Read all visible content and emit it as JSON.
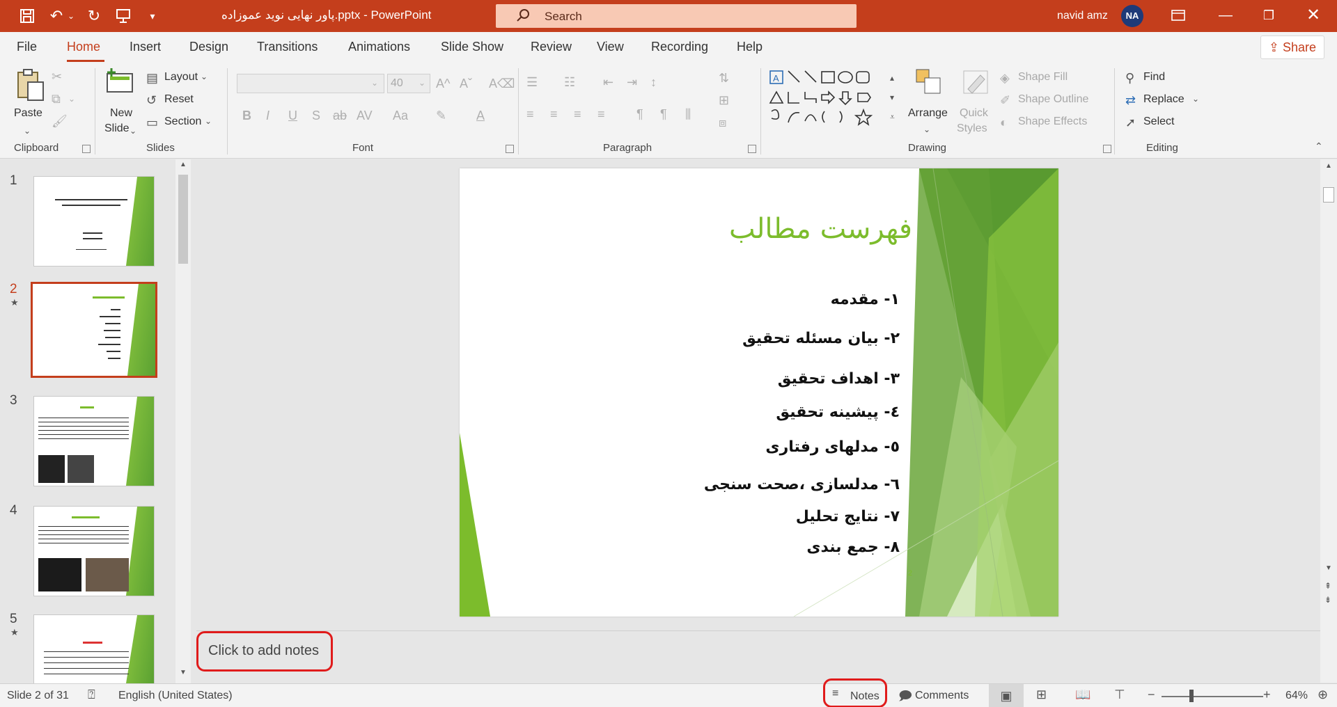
{
  "titlebar": {
    "doc_title": "پاور نهایی نوید عموزاده.pptx  -  PowerPoint",
    "search_label": "Search",
    "user_name": "navid amz",
    "user_initials": "NA",
    "bg_color": "#c43e1c"
  },
  "tabs": [
    "File",
    "Home",
    "Insert",
    "Design",
    "Transitions",
    "Animations",
    "Slide Show",
    "Review",
    "View",
    "Recording",
    "Help"
  ],
  "active_tab": "Home",
  "share_label": "Share",
  "ribbon": {
    "clipboard": {
      "label": "Clipboard",
      "paste": "Paste"
    },
    "slides": {
      "label": "Slides",
      "new_slide_line1": "New",
      "new_slide_line2": "Slide",
      "layout": "Layout",
      "reset": "Reset",
      "section": "Section"
    },
    "font": {
      "label": "Font",
      "size": "40"
    },
    "paragraph": {
      "label": "Paragraph"
    },
    "drawing": {
      "label": "Drawing",
      "arrange": "Arrange",
      "quick_styles_line1": "Quick",
      "quick_styles_line2": "Styles",
      "shape_fill": "Shape Fill",
      "shape_outline": "Shape Outline",
      "shape_effects": "Shape Effects"
    },
    "editing": {
      "label": "Editing",
      "find": "Find",
      "replace": "Replace",
      "select": "Select"
    }
  },
  "thumbnails": [
    "1",
    "2",
    "3",
    "4",
    "5"
  ],
  "selected_slide": "2",
  "slide": {
    "title": "فهرست مطالب",
    "items": [
      "۱- مقدمه",
      "۲- بیان مسئله تحقیق",
      "۳- اهداف تحقیق",
      "٤- پیشینه تحقیق",
      "٥- مدلهای رفتاری",
      "٦- مدلسازی ،صحت سنجی",
      "۷- نتایج تحلیل",
      "۸- جمع بندی"
    ],
    "number": "2",
    "accent_color": "#7cbc2c"
  },
  "notes_placeholder": "Click to add notes",
  "statusbar": {
    "slide_info": "Slide 2 of 31",
    "language": "English (United States)",
    "notes": "Notes",
    "comments": "Comments",
    "zoom": "64%"
  }
}
